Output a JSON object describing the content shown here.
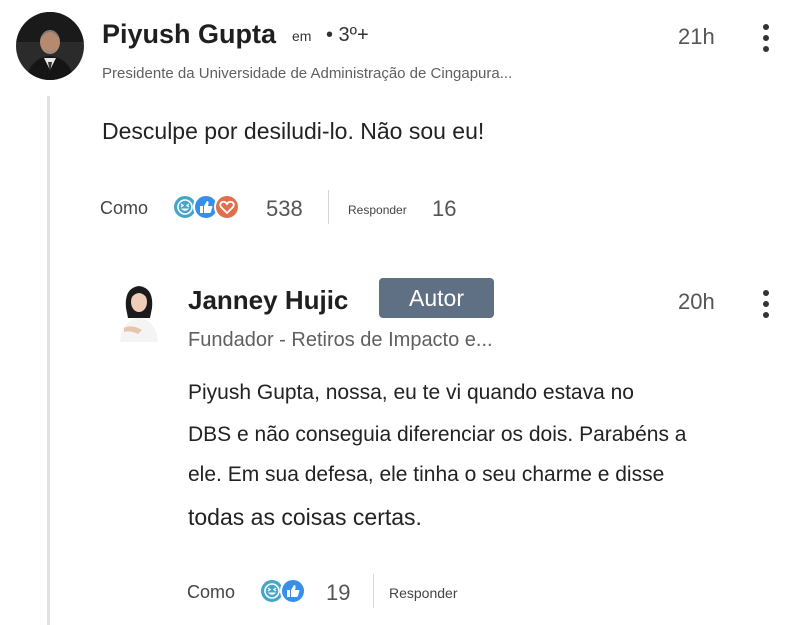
{
  "comment": {
    "author_name": "Piyush Gupta",
    "connection_prefix": "em",
    "connection_degree": "• 3º+",
    "headline": "Presidente da Universidade de Administração de Cingapura...",
    "timestamp": "21h",
    "text": "Desculpe por desiludi-lo. Não sou eu!",
    "like_label": "Como",
    "reaction_count": "538",
    "reply_label": "Responder",
    "reply_count": "16",
    "reaction_icons": [
      "laugh-reaction-icon",
      "like-reaction-icon",
      "love-reaction-icon"
    ]
  },
  "reply": {
    "author_name": "Janney Hujic",
    "author_badge": "Autor",
    "headline": "Fundador - Retiros de Impacto e...",
    "timestamp": "20h",
    "text_lines": [
      "Piyush Gupta, nossa, eu te vi quando estava no",
      "DBS e não conseguia diferenciar os dois. Parabéns a",
      "ele. Em sua defesa, ele tinha o seu charme e disse",
      "todas as coisas certas."
    ],
    "like_label": "Como",
    "reaction_count": "19",
    "reply_label": "Responder",
    "reaction_icons": [
      "laugh-reaction-icon",
      "like-reaction-icon"
    ]
  },
  "colors": {
    "badge_bg": "#5f6f84",
    "laugh": "#44a6c8",
    "like": "#378fe9",
    "love": "#df704d",
    "thread_line": "#e2e2e2"
  }
}
